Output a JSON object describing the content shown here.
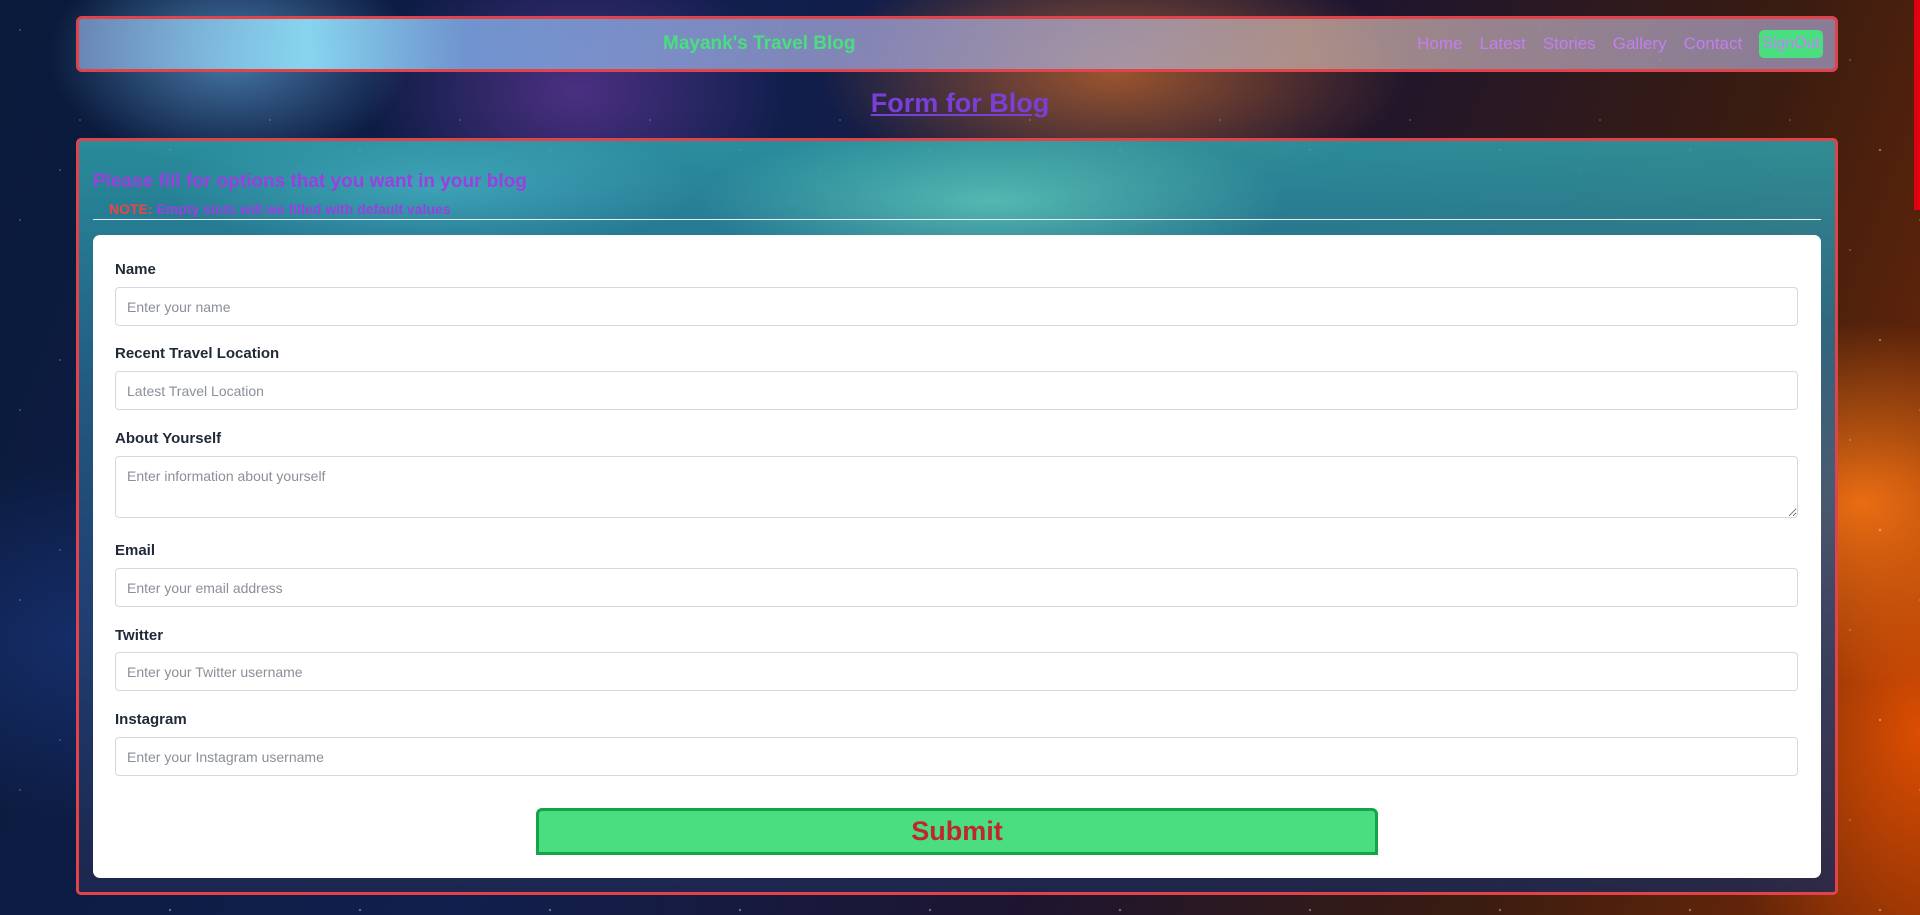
{
  "navbar": {
    "brand": "Mayank's Travel Blog",
    "links": [
      "Home",
      "Latest",
      "Stories",
      "Gallery",
      "Contact"
    ],
    "signout_label": "SignOut"
  },
  "page_title": "Form for Blog",
  "form": {
    "heading": "Please fill for options that you want in your blog",
    "note_label": "NOTE:",
    "note_text": "Empty slots will we filled with default values",
    "fields": [
      {
        "label": "Name",
        "placeholder": "Enter your name",
        "value": ""
      },
      {
        "label": "Recent Travel Location",
        "placeholder": "Latest Travel Location",
        "value": ""
      },
      {
        "label": "About Yourself",
        "placeholder": "Enter information about yourself",
        "value": ""
      },
      {
        "label": "Email",
        "placeholder": "Enter your email address",
        "value": ""
      },
      {
        "label": "Twitter",
        "placeholder": "Enter your Twitter username",
        "value": ""
      },
      {
        "label": "Instagram",
        "placeholder": "Enter your Instagram username",
        "value": ""
      }
    ],
    "submit_label": "Submit"
  },
  "colors": {
    "accent_green": "#4ade80",
    "accent_purple": "#9b3fe0",
    "border_red": "#e0434a",
    "submit_text": "#c0262d"
  }
}
